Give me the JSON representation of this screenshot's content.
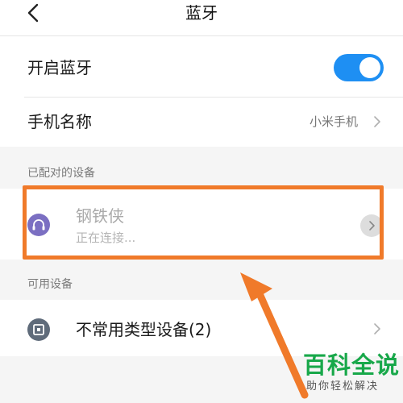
{
  "header": {
    "title": "蓝牙"
  },
  "settings": {
    "bluetooth_label": "开启蓝牙",
    "bluetooth_enabled": true,
    "phone_name_label": "手机名称",
    "phone_name_value": "小米手机"
  },
  "paired": {
    "section_label": "已配对的设备",
    "devices": [
      {
        "name": "钢铁侠",
        "status": "正在连接...",
        "icon": "headset-icon"
      }
    ]
  },
  "available": {
    "section_label": "可用设备",
    "devices": [
      {
        "name": "不常用类型设备(2)",
        "icon": "device-icon"
      }
    ]
  },
  "watermark": {
    "main": "百科全说",
    "sub": "助你轻松解决"
  },
  "colors": {
    "toggle_on": "#1e8ff3",
    "highlight": "#f07a2a",
    "headset_icon_bg": "#7b6fc2",
    "device_icon_bg": "#5f6b7a",
    "watermark": "#18a84a"
  }
}
